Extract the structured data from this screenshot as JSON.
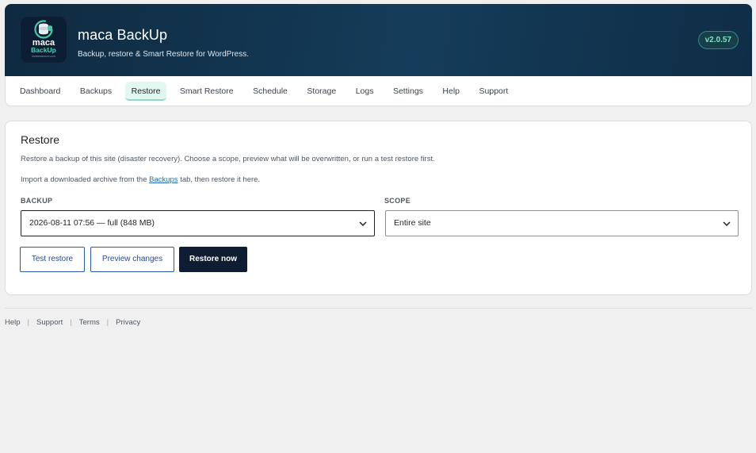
{
  "header": {
    "app_name": "maca BackUp",
    "tagline": "Backup, restore & Smart Restore for WordPress.",
    "version": "v2.0.57",
    "logo": {
      "line1": "maca",
      "line2": "BackUp",
      "line3": "WORDPRESS PLUGIN"
    }
  },
  "tabs": [
    {
      "label": "Dashboard"
    },
    {
      "label": "Backups"
    },
    {
      "label": "Restore",
      "active": true
    },
    {
      "label": "Smart Restore"
    },
    {
      "label": "Schedule"
    },
    {
      "label": "Storage"
    },
    {
      "label": "Logs"
    },
    {
      "label": "Settings"
    },
    {
      "label": "Help"
    },
    {
      "label": "Support"
    }
  ],
  "restore": {
    "title": "Restore",
    "description": "Restore a backup of this site (disaster recovery). Choose a scope, preview what will be overwritten, or run a test restore first.",
    "import_note_before": "Import a downloaded archive from the ",
    "import_note_link": "Backups",
    "import_note_after": " tab, then restore it here.",
    "backup_label": "BACKUP",
    "backup_value": "2026-08-11 07:56 — full (848 MB)",
    "scope_label": "SCOPE",
    "scope_value": "Entire site",
    "buttons": {
      "test": "Test restore",
      "preview": "Preview changes",
      "restore": "Restore now"
    }
  },
  "footer": {
    "links": [
      "Help",
      "Support",
      "Terms",
      "Privacy"
    ],
    "separator": "|"
  },
  "colors": {
    "header_bg": "#143c5a",
    "accent": "#7ee5c8",
    "primary_button": "#0f1d33",
    "active_tab": "#e3f7f2"
  },
  "icons": [
    "logo-icon",
    "chevron-down-icon"
  ]
}
